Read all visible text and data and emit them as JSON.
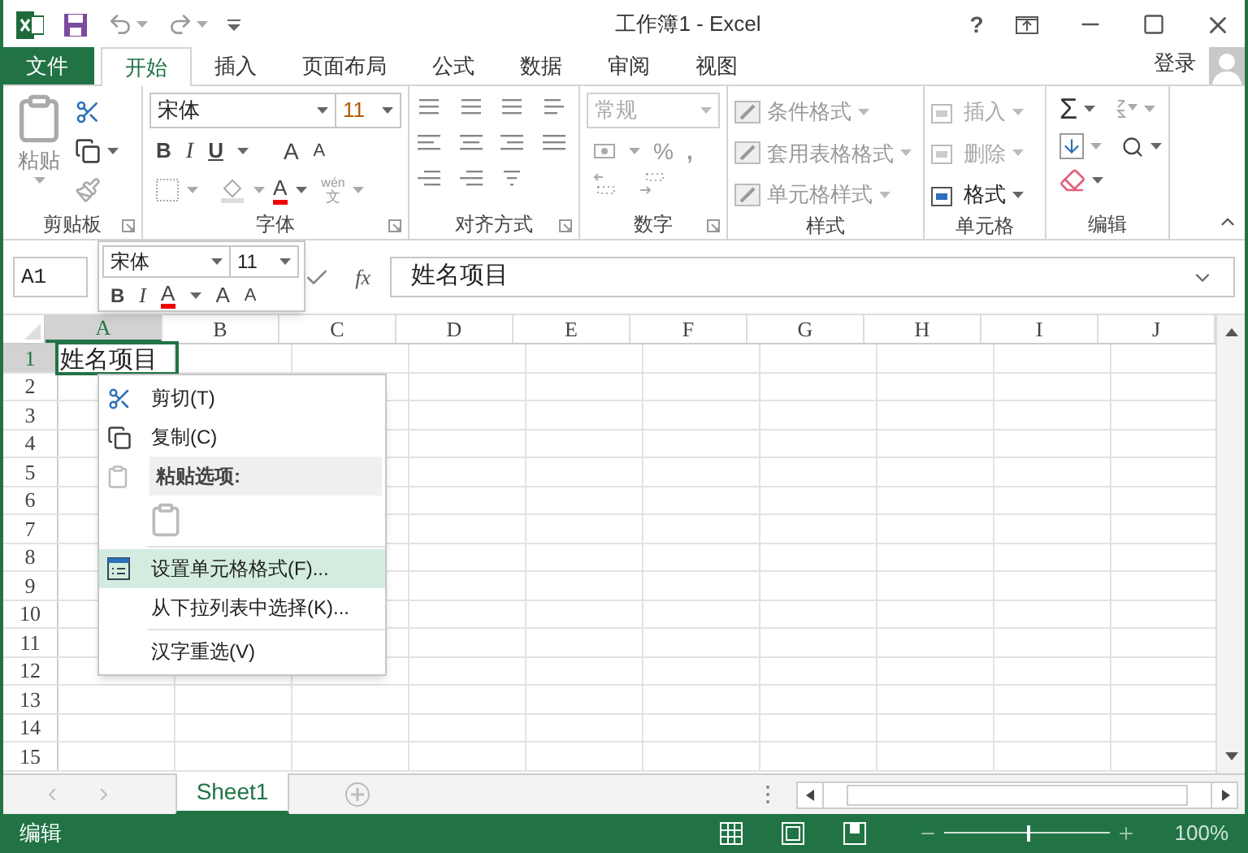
{
  "window": {
    "title": "工作簿1 - Excel",
    "help": "?"
  },
  "tabs": [
    {
      "label": "文件",
      "kind": "file",
      "selected": false
    },
    {
      "label": "开始",
      "kind": "tab",
      "selected": true
    },
    {
      "label": "插入",
      "kind": "tab",
      "selected": false
    },
    {
      "label": "页面布局",
      "kind": "tab",
      "selected": false
    },
    {
      "label": "公式",
      "kind": "tab",
      "selected": false
    },
    {
      "label": "数据",
      "kind": "tab",
      "selected": false
    },
    {
      "label": "审阅",
      "kind": "tab",
      "selected": false
    },
    {
      "label": "视图",
      "kind": "tab",
      "selected": false
    }
  ],
  "account": {
    "label": "登录"
  },
  "ribbon": {
    "clipboard": {
      "paste": "粘贴",
      "label": "剪贴板"
    },
    "font": {
      "name": "宋体",
      "size": "11",
      "bold": "B",
      "italic": "I",
      "underline": "U",
      "grow": "A",
      "shrink": "A",
      "color_letter": "A",
      "phonetic_top": "wén",
      "phonetic_bottom": "文",
      "label": "字体"
    },
    "alignment": {
      "label": "对齐方式"
    },
    "number": {
      "format": "常规",
      "percent": "%",
      "comma": ",",
      "label": "数字"
    },
    "styles": {
      "items": [
        "条件格式",
        "套用表格格式",
        "单元格样式"
      ],
      "label": "样式"
    },
    "cells": {
      "items": [
        {
          "label": "插入",
          "disabled": true
        },
        {
          "label": "删除",
          "disabled": true
        },
        {
          "label": "格式",
          "disabled": false
        }
      ],
      "label": "单元格"
    },
    "editing": {
      "autosum": "Σ",
      "label": "编辑"
    }
  },
  "formula_bar": {
    "name_box": "A1",
    "fx": "fx",
    "value": "姓名项目"
  },
  "grid": {
    "columns": [
      {
        "label": "A",
        "selected": true
      },
      {
        "label": "B",
        "selected": false
      },
      {
        "label": "C",
        "selected": false
      },
      {
        "label": "D",
        "selected": false
      },
      {
        "label": "E",
        "selected": false
      },
      {
        "label": "F",
        "selected": false
      },
      {
        "label": "G",
        "selected": false
      },
      {
        "label": "H",
        "selected": false
      },
      {
        "label": "I",
        "selected": false
      },
      {
        "label": "J",
        "selected": false
      }
    ],
    "rows": [
      {
        "label": "1",
        "selected": true
      },
      {
        "label": "2",
        "selected": false
      },
      {
        "label": "3",
        "selected": false
      },
      {
        "label": "4",
        "selected": false
      },
      {
        "label": "5",
        "selected": false
      },
      {
        "label": "6",
        "selected": false
      },
      {
        "label": "7",
        "selected": false
      },
      {
        "label": "8",
        "selected": false
      },
      {
        "label": "9",
        "selected": false
      },
      {
        "label": "10",
        "selected": false
      },
      {
        "label": "11",
        "selected": false
      },
      {
        "label": "12",
        "selected": false
      },
      {
        "label": "13",
        "selected": false
      },
      {
        "label": "14",
        "selected": false
      },
      {
        "label": "15",
        "selected": false
      }
    ],
    "active_cell": {
      "value": "姓名项目"
    }
  },
  "mini_toolbar": {
    "font": "宋体",
    "size": "11",
    "bold": "B",
    "italic": "I",
    "color_letter": "A",
    "grow": "A",
    "shrink": "A"
  },
  "context_menu": [
    {
      "kind": "item",
      "label": "剪切(T)",
      "selected": false
    },
    {
      "kind": "item",
      "label": "复制(C)",
      "selected": false
    },
    {
      "kind": "header",
      "label": "粘贴选项:"
    },
    {
      "kind": "paste"
    },
    {
      "kind": "item",
      "label": "设置单元格格式(F)...",
      "selected": true
    },
    {
      "kind": "item",
      "label": "从下拉列表中选择(K)...",
      "selected": false
    },
    {
      "kind": "item",
      "label": "汉字重选(V)",
      "selected": false
    }
  ],
  "sheet_tabs": [
    {
      "label": "Sheet1",
      "selected": true
    }
  ],
  "status_bar": {
    "mode": "编辑",
    "zoom": "100%",
    "level": 0.5
  }
}
